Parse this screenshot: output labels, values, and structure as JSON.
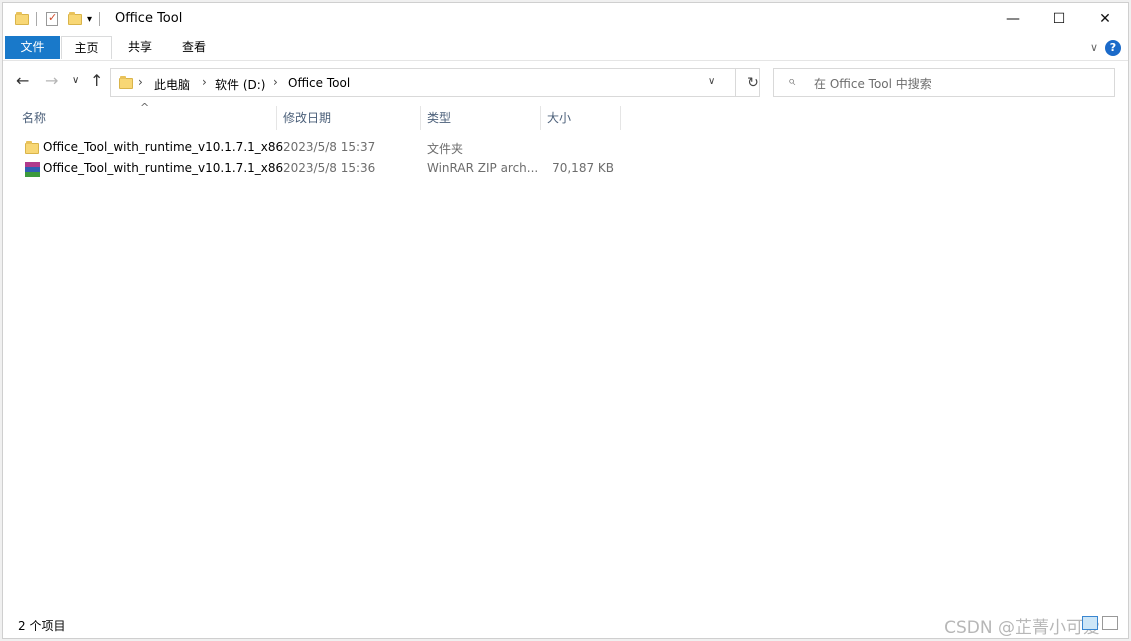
{
  "window": {
    "title": "Office Tool"
  },
  "ribbon": {
    "tabs": [
      "文件",
      "主页",
      "共享",
      "查看"
    ]
  },
  "address": {
    "segments": [
      "此电脑",
      "软件 (D:)",
      "Office Tool"
    ]
  },
  "search": {
    "placeholder": "在 Office Tool 中搜索"
  },
  "columns": [
    "名称",
    "修改日期",
    "类型",
    "大小"
  ],
  "files": [
    {
      "name": "Office_Tool_with_runtime_v10.1.7.1_x86",
      "date": "2023/5/8 15:37",
      "type": "文件夹",
      "size": "",
      "icon": "folder-icon"
    },
    {
      "name": "Office_Tool_with_runtime_v10.1.7.1_x86",
      "date": "2023/5/8 15:36",
      "type": "WinRAR ZIP arch...",
      "size": "70,187 KB",
      "icon": "winrar-icon"
    }
  ],
  "status": {
    "item_count": "2 个项目"
  },
  "watermark": "CSDN @芷菁小可爱",
  "colors": {
    "accent": "#1979ca",
    "header_text": "#4c607a",
    "help": "#1b6ac9"
  }
}
